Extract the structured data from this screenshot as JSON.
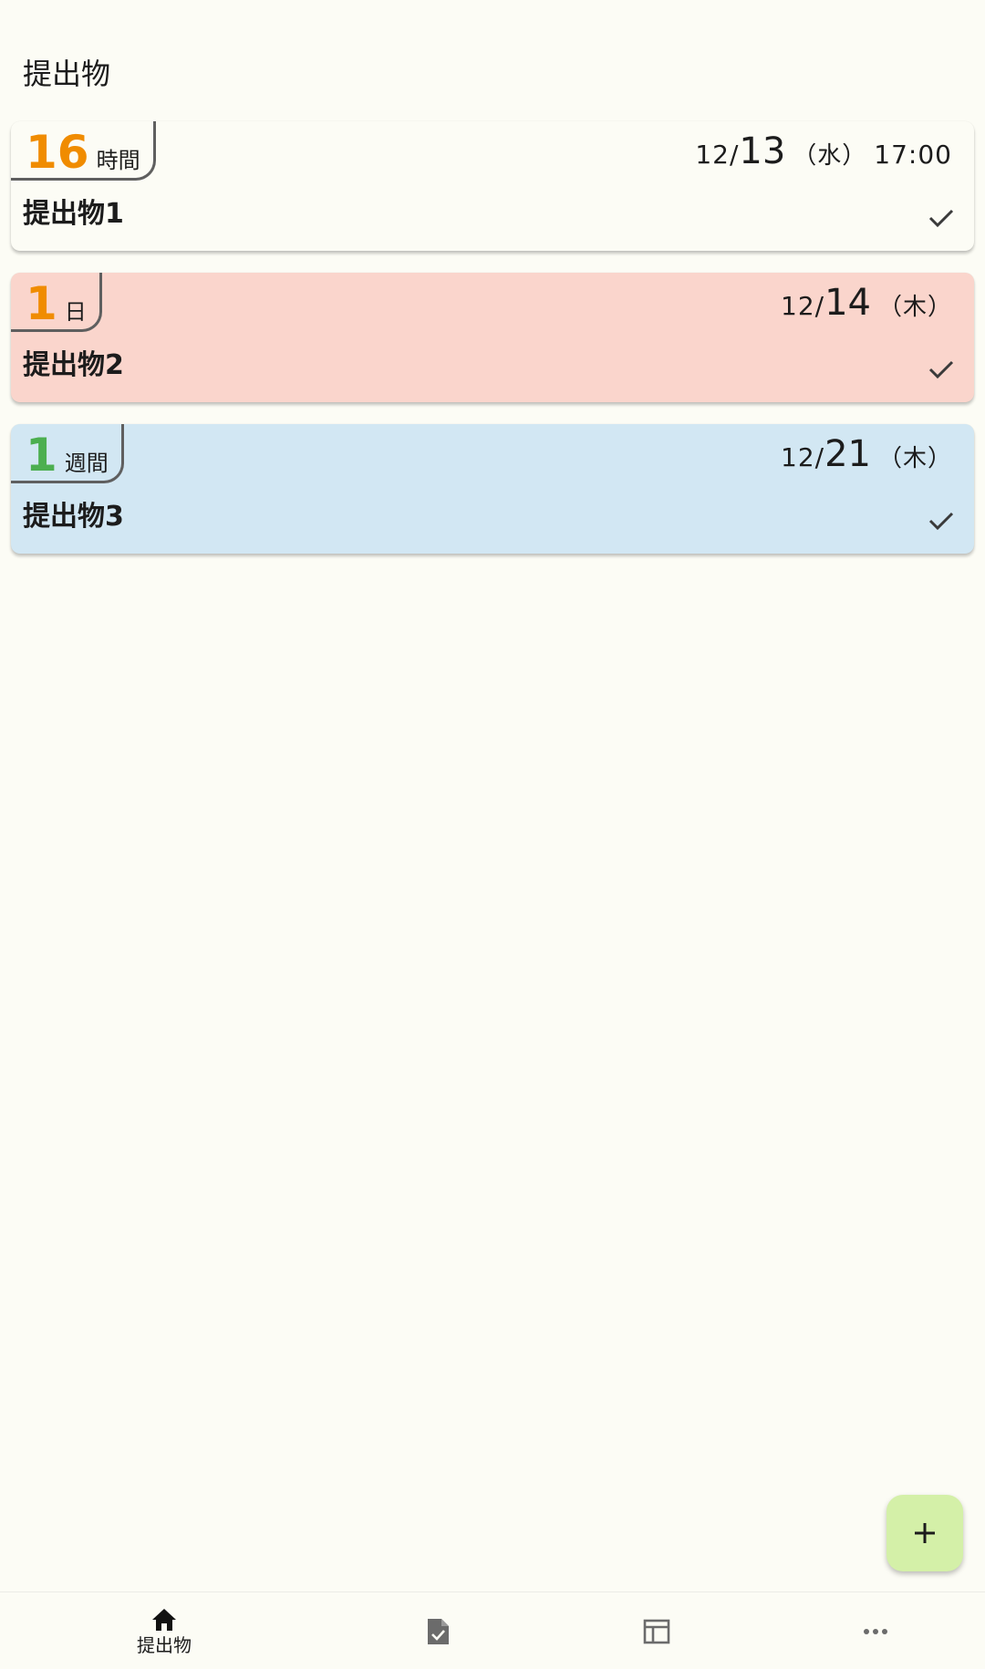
{
  "header": {
    "title": "提出物"
  },
  "cards": [
    {
      "remaining_value": "16",
      "remaining_unit": "時間",
      "remaining_color": "#f08c00",
      "due_month": "12/",
      "due_day": "13",
      "due_weekday": "（水）",
      "due_time": "17:00",
      "name": "提出物1",
      "background": "#fcfcf5",
      "check_icon": "check-icon"
    },
    {
      "remaining_value": "1",
      "remaining_unit": "日",
      "remaining_color": "#f08c00",
      "due_month": "12/",
      "due_day": "14",
      "due_weekday": "（木）",
      "due_time": "",
      "name": "提出物2",
      "background": "#fad5cc",
      "check_icon": "check-icon"
    },
    {
      "remaining_value": "1",
      "remaining_unit": "週間",
      "remaining_color": "#4caf50",
      "due_month": "12/",
      "due_day": "21",
      "due_weekday": "（木）",
      "due_time": "",
      "name": "提出物3",
      "background": "#d2e7f3",
      "check_icon": "check-icon"
    }
  ],
  "fab": {
    "icon": "plus-icon",
    "color": "#d4f0a8"
  },
  "bottom_nav": {
    "items": [
      {
        "icon": "home-icon",
        "label": "提出物",
        "active": true
      },
      {
        "icon": "document-check-icon",
        "label": ""
      },
      {
        "icon": "table-icon",
        "label": ""
      },
      {
        "icon": "more-icon",
        "label": ""
      }
    ]
  }
}
